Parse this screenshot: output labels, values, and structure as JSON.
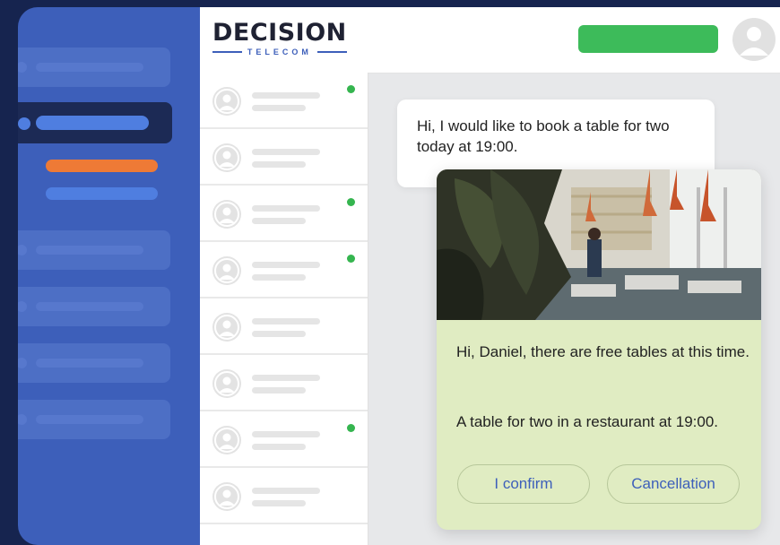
{
  "logo": {
    "main": "DECISION",
    "sub": "TELECOM"
  },
  "header": {
    "action_button_color": "#3dbb5a"
  },
  "sidebar": {
    "accent_orange": "#ee7a36",
    "accent_blue": "#4f7ee0"
  },
  "chat_list": {
    "rows": [
      {
        "online": true
      },
      {
        "online": false
      },
      {
        "online": true
      },
      {
        "online": true
      },
      {
        "online": false
      },
      {
        "online": false
      },
      {
        "online": true
      },
      {
        "online": false
      }
    ]
  },
  "conversation": {
    "incoming_message": "Hi, I would like to book a table for two today at 19:00.",
    "reply": {
      "text_1": "Hi, Daniel, there are free tables at this time.",
      "text_2": "A table for two in a restaurant at 19:00.",
      "confirm_label": "I confirm",
      "cancel_label": "Cancellation"
    }
  }
}
